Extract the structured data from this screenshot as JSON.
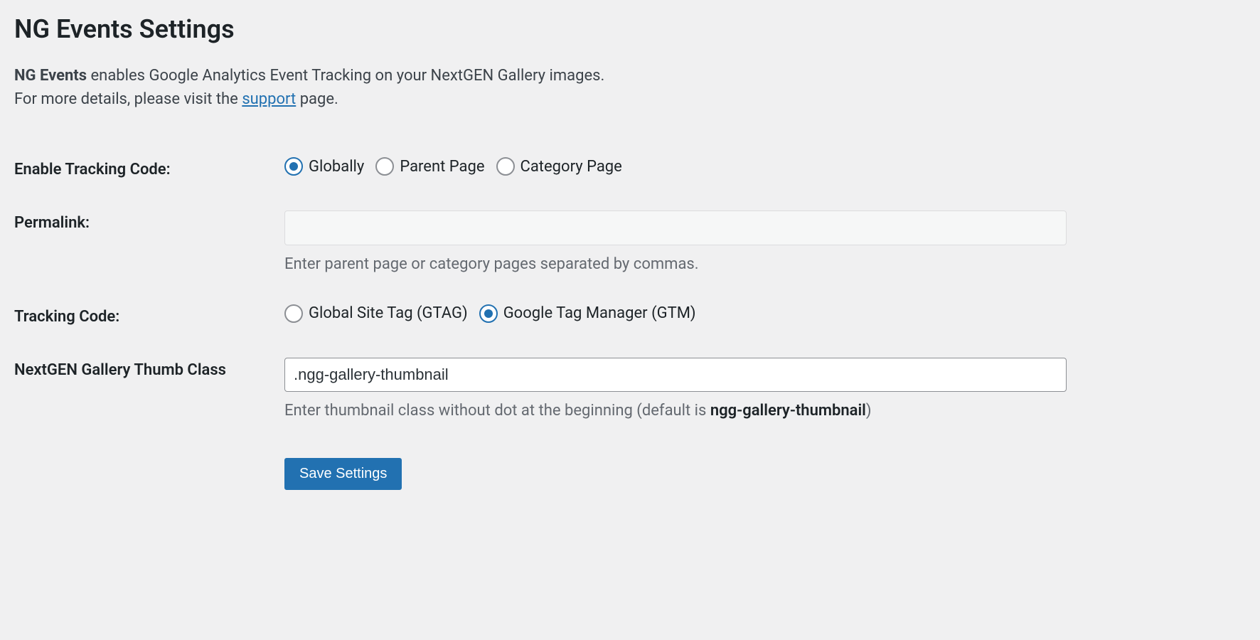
{
  "page": {
    "title": "NG Events Settings",
    "intro_strong": "NG Events",
    "intro_rest": " enables Google Analytics Event Tracking on your NextGEN Gallery images.",
    "intro_line2_pre": "For more details, please visit the ",
    "intro_link": "support",
    "intro_line2_post": " page."
  },
  "fields": {
    "enable_tracking": {
      "label": "Enable Tracking Code:",
      "options": {
        "globally": "Globally",
        "parent_page": "Parent Page",
        "category_page": "Category Page"
      },
      "selected": "globally"
    },
    "permalink": {
      "label": "Permalink:",
      "value": "",
      "help": "Enter parent page or category pages separated by commas."
    },
    "tracking_code": {
      "label": "Tracking Code:",
      "options": {
        "gtag": "Global Site Tag (GTAG)",
        "gtm": "Google Tag Manager (GTM)"
      },
      "selected": "gtm"
    },
    "thumb_class": {
      "label": "NextGEN Gallery Thumb Class",
      "value": ".ngg-gallery-thumbnail",
      "help_pre": "Enter thumbnail class without dot at the beginning (default is ",
      "help_strong": "ngg-gallery-thumbnail",
      "help_post": ")"
    }
  },
  "buttons": {
    "save": "Save Settings"
  }
}
